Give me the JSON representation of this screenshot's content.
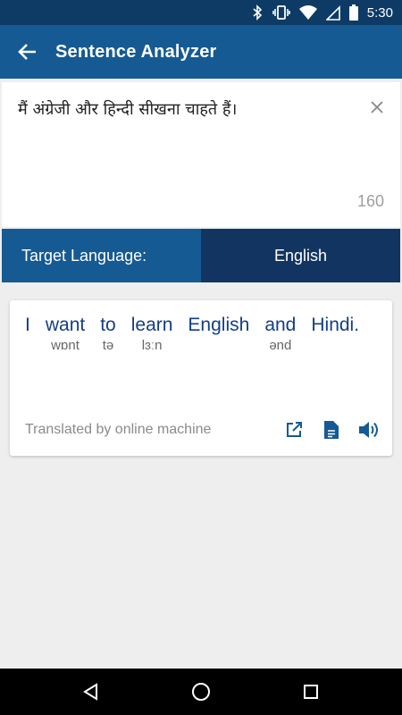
{
  "status_bar": {
    "time": "5:30",
    "icons": [
      "bluetooth-icon",
      "vibrate-icon",
      "wifi-icon",
      "signal-icon",
      "battery-icon"
    ]
  },
  "app_bar": {
    "title": "Sentence Analyzer",
    "back_icon": "arrow-back-icon"
  },
  "input": {
    "text": "मैं अंग्रेजी और हिन्दी सीखना चाहते हैं।",
    "char_count": "160",
    "clear_icon": "close-icon"
  },
  "target_language": {
    "label": "Target Language:",
    "value": "English"
  },
  "result": {
    "words": [
      {
        "word": "I",
        "phonetic": ""
      },
      {
        "word": "want",
        "phonetic": "wɒnt"
      },
      {
        "word": "to",
        "phonetic": "tə"
      },
      {
        "word": "learn",
        "phonetic": "lɜːn"
      },
      {
        "word": "English",
        "phonetic": ""
      },
      {
        "word": "and",
        "phonetic": "ənd"
      },
      {
        "word": "Hindi.",
        "phonetic": ""
      }
    ],
    "footer_text": "Translated by online machine",
    "actions": [
      "open-external-icon",
      "document-icon",
      "speaker-icon"
    ]
  },
  "colors": {
    "primary_dark": "#0d3b66",
    "primary": "#155a93",
    "lang_value_bg": "#123460",
    "word_color": "#123e86"
  },
  "nav_bar": {
    "icons": [
      "back-triangle-icon",
      "home-circle-icon",
      "recents-square-icon"
    ]
  }
}
